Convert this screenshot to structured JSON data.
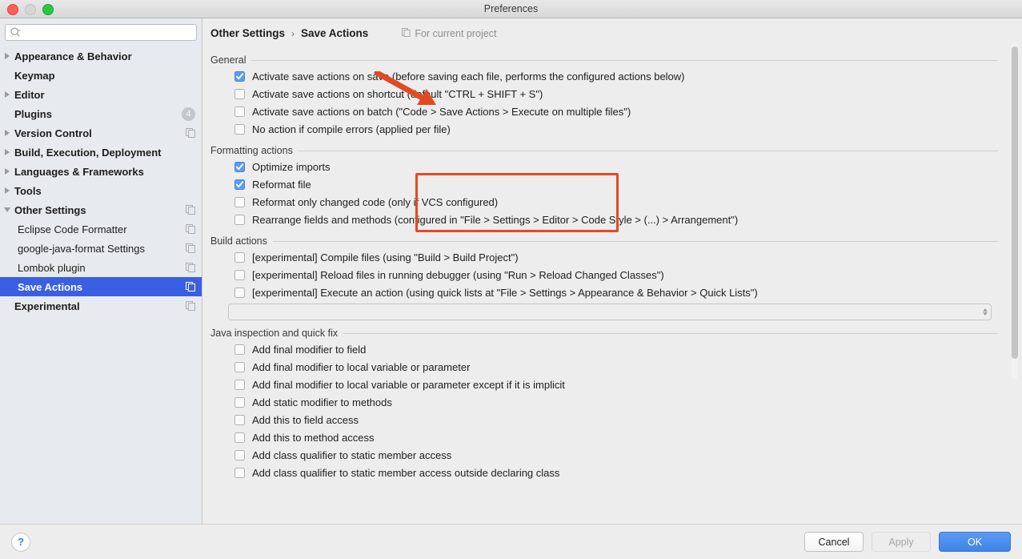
{
  "window": {
    "title": "Preferences",
    "traffic_lights": [
      "close",
      "minimize",
      "zoom"
    ]
  },
  "sidebar": {
    "search": {
      "value": "",
      "placeholder": ""
    },
    "items": [
      {
        "label": "Appearance & Behavior",
        "level": 0,
        "arrow": "collapsed",
        "badge": null,
        "copy_icon": false,
        "selected": false
      },
      {
        "label": "Keymap",
        "level": 0,
        "arrow": "none",
        "badge": null,
        "copy_icon": false,
        "selected": false
      },
      {
        "label": "Editor",
        "level": 0,
        "arrow": "collapsed",
        "badge": null,
        "copy_icon": false,
        "selected": false
      },
      {
        "label": "Plugins",
        "level": 0,
        "arrow": "none",
        "badge": "4",
        "copy_icon": false,
        "selected": false
      },
      {
        "label": "Version Control",
        "level": 0,
        "arrow": "collapsed",
        "badge": null,
        "copy_icon": true,
        "selected": false
      },
      {
        "label": "Build, Execution, Deployment",
        "level": 0,
        "arrow": "collapsed",
        "badge": null,
        "copy_icon": false,
        "selected": false
      },
      {
        "label": "Languages & Frameworks",
        "level": 0,
        "arrow": "collapsed",
        "badge": null,
        "copy_icon": false,
        "selected": false
      },
      {
        "label": "Tools",
        "level": 0,
        "arrow": "collapsed",
        "badge": null,
        "copy_icon": false,
        "selected": false
      },
      {
        "label": "Other Settings",
        "level": 0,
        "arrow": "expanded",
        "badge": null,
        "copy_icon": true,
        "selected": false
      },
      {
        "label": "Eclipse Code Formatter",
        "level": 1,
        "arrow": "none",
        "badge": null,
        "copy_icon": true,
        "selected": false
      },
      {
        "label": "google-java-format Settings",
        "level": 1,
        "arrow": "none",
        "badge": null,
        "copy_icon": true,
        "selected": false
      },
      {
        "label": "Lombok plugin",
        "level": 1,
        "arrow": "none",
        "badge": null,
        "copy_icon": true,
        "selected": false
      },
      {
        "label": "Save Actions",
        "level": 1,
        "arrow": "none",
        "badge": null,
        "copy_icon": true,
        "selected": true
      },
      {
        "label": "Experimental",
        "level": 0,
        "arrow": "none",
        "badge": null,
        "copy_icon": true,
        "selected": false
      }
    ]
  },
  "header": {
    "breadcrumb_root": "Other Settings",
    "breadcrumb_sep": "›",
    "breadcrumb_leaf": "Save Actions",
    "for_current_project": "For current project"
  },
  "sections": [
    {
      "title": "General",
      "options": [
        {
          "label": "Activate save actions on save (before saving each file, performs the configured actions below)",
          "checked": true
        },
        {
          "label": "Activate save actions on shortcut (default \"CTRL + SHIFT + S\")",
          "checked": false
        },
        {
          "label": "Activate save actions on batch (\"Code > Save Actions > Execute on multiple files\")",
          "checked": false
        },
        {
          "label": "No action if compile errors (applied per file)",
          "checked": false
        }
      ]
    },
    {
      "title": "Formatting actions",
      "options": [
        {
          "label": "Optimize imports",
          "checked": true
        },
        {
          "label": "Reformat file",
          "checked": true
        },
        {
          "label": "Reformat only changed code (only if VCS configured)",
          "checked": false
        },
        {
          "label": "Rearrange fields and methods (configured in \"File > Settings > Editor > Code Style > (...) > Arrangement\")",
          "checked": false
        }
      ]
    },
    {
      "title": "Build actions",
      "options": [
        {
          "label": "[experimental] Compile files (using \"Build > Build Project\")",
          "checked": false
        },
        {
          "label": "[experimental] Reload files in running debugger (using \"Run > Reload Changed Classes\")",
          "checked": false
        },
        {
          "label": "[experimental] Execute an action (using quick lists at \"File > Settings > Appearance & Behavior > Quick Lists\")",
          "checked": false
        }
      ],
      "spinner": {
        "value": ""
      }
    },
    {
      "title": "Java inspection and quick fix",
      "options": [
        {
          "label": "Add final modifier to field",
          "checked": false
        },
        {
          "label": "Add final modifier to local variable or parameter",
          "checked": false
        },
        {
          "label": "Add final modifier to local variable or parameter except if it is implicit",
          "checked": false
        },
        {
          "label": "Add static modifier to methods",
          "checked": false
        },
        {
          "label": "Add this to field access",
          "checked": false
        },
        {
          "label": "Add this to method access",
          "checked": false
        },
        {
          "label": "Add class qualifier to static member access",
          "checked": false
        },
        {
          "label": "Add class qualifier to static member access outside declaring class",
          "checked": false
        }
      ]
    }
  ],
  "annotations": {
    "highlight_color": "#e54a24",
    "arrow_target": "activate-save-actions-on-save-checkbox",
    "box_target": "formatting-actions-group"
  },
  "footer": {
    "help_label": "?",
    "cancel_label": "Cancel",
    "apply_label": "Apply",
    "ok_label": "OK",
    "apply_disabled": true
  }
}
